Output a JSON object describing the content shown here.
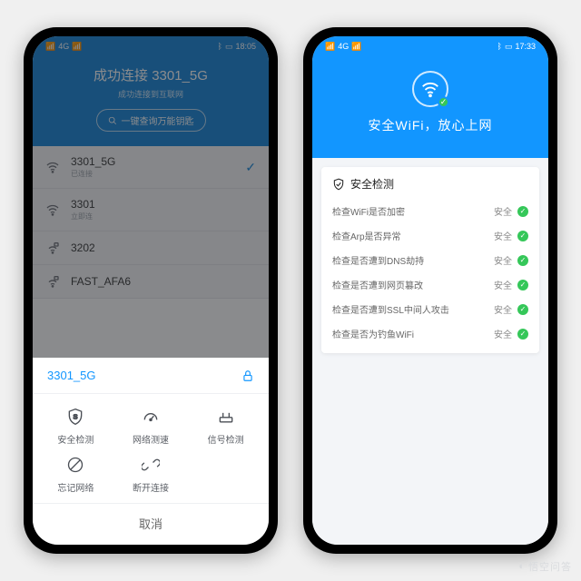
{
  "statusbar": {
    "left_signal": "4G",
    "bt": "⚪",
    "time_left": "18:05",
    "time_right": "17:33"
  },
  "left": {
    "header_title": "成功连接 3301_5G",
    "header_subtitle": "成功连接到互联网",
    "pill_label": "一键查询万能钥匙",
    "networks": [
      {
        "ssid": "3301_5G",
        "tag": "已连接",
        "connected": true
      },
      {
        "ssid": "3301",
        "tag": "立即连"
      },
      {
        "ssid": "3202",
        "tag": ""
      },
      {
        "ssid": "FAST_AFA6",
        "tag": ""
      }
    ],
    "sheet": {
      "title": "3301_5G",
      "actions": {
        "security": "安全检测",
        "speed": "网络测速",
        "signal": "信号检测",
        "forget": "忘记网络",
        "disconnect": "断开连接"
      },
      "cancel": "取消"
    }
  },
  "right": {
    "hero_text": "安全WiFi，放心上网",
    "card_title": "安全检测",
    "safe_label": "安全",
    "checks": [
      "检查WiFi是否加密",
      "检查Arp是否异常",
      "检查是否遭到DNS劫持",
      "检查是否遭到网页篡改",
      "检查是否遭到SSL中间人攻击",
      "检查是否为钓鱼WiFi"
    ]
  },
  "watermark": "悟空问答"
}
